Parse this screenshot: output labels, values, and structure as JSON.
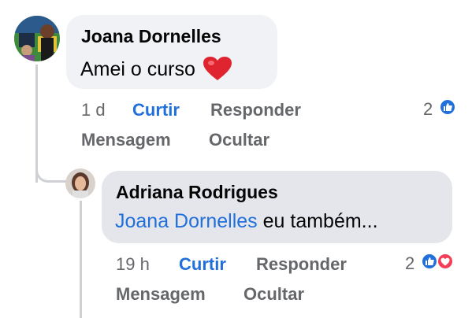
{
  "comments": [
    {
      "author": "Joana Dornelles",
      "text": "Amei o curso",
      "time": "1 d",
      "like_label": "Curtir",
      "reply_label": "Responder",
      "message_label": "Mensagem",
      "hide_label": "Ocultar",
      "reaction_count": "2",
      "reactions": [
        "like-icon"
      ]
    },
    {
      "author": "Adriana Rodrigues",
      "mention": "Joana Dornelles",
      "text": " eu também...",
      "time": "19 h",
      "like_label": "Curtir",
      "reply_label": "Responder",
      "message_label": "Mensagem",
      "hide_label": "Ocultar",
      "reaction_count": "2",
      "reactions": [
        "like-icon",
        "love-icon"
      ]
    }
  ],
  "colors": {
    "link_blue": "#216fdb",
    "bubble_bg": "#f0f2f5",
    "reply_bubble_bg": "#e4e6eb",
    "muted_text": "#65676b",
    "love_red": "#f33e58"
  }
}
